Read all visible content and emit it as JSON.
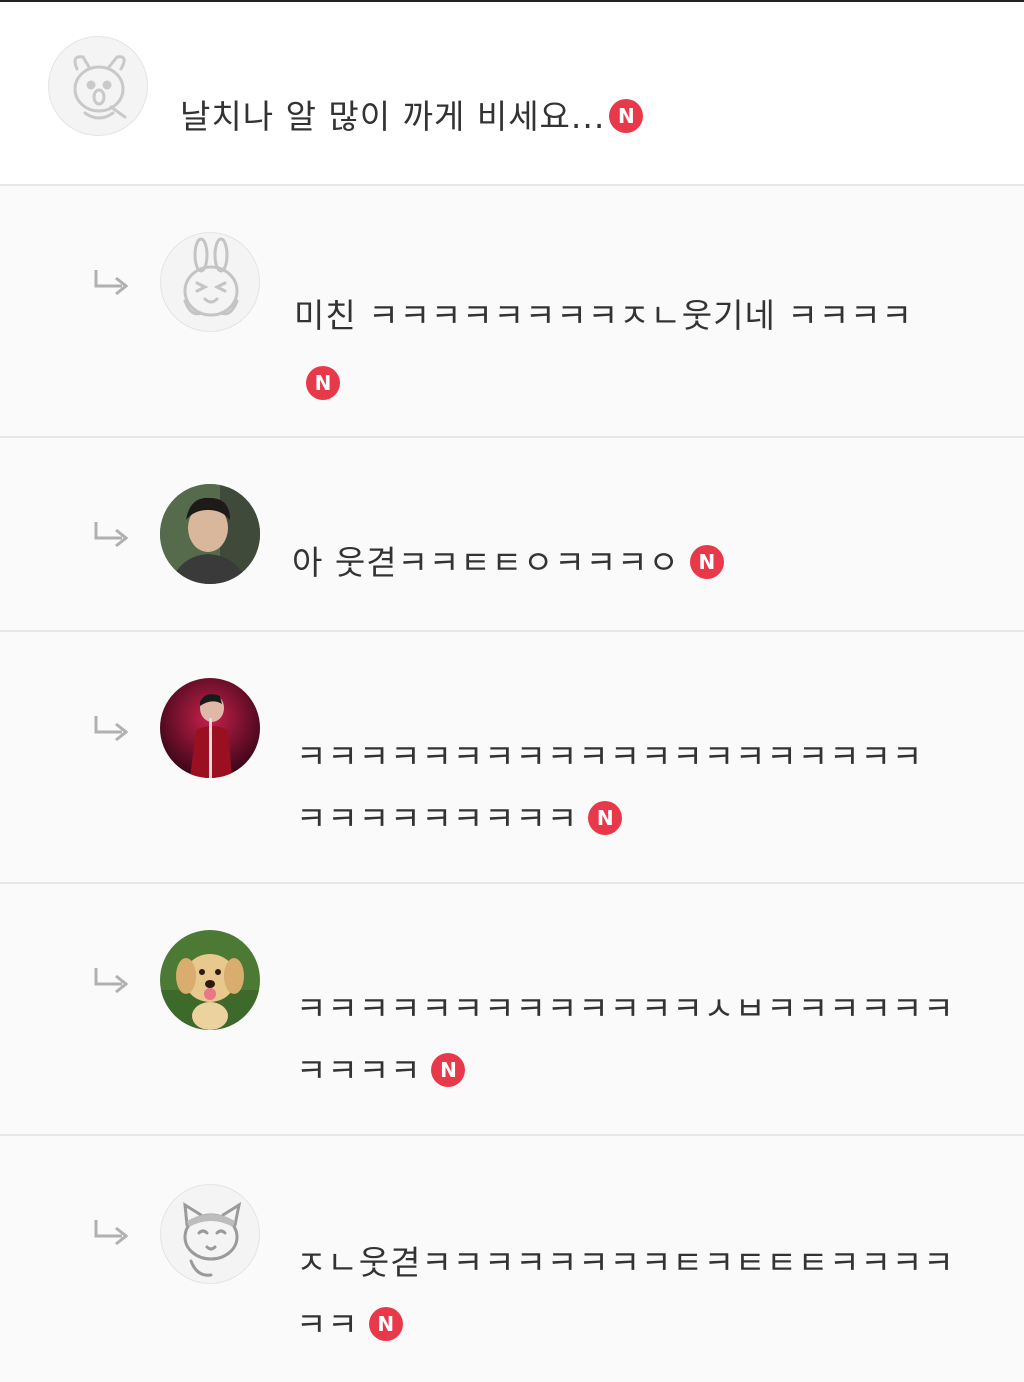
{
  "comments": [
    {
      "text": "날치나 알 많이 까게 비세요...",
      "avatar": "dog-character-icon",
      "badge": "N"
    },
    {
      "text": "미친 ㅋㅋㅋㅋㅋㅋㅋㅋㅈㄴ웃기네 ㅋㅋㅋㅋ",
      "avatar": "rabbit-character-icon",
      "badge": "N"
    },
    {
      "text": "아 웃겯ㅋㅋㅌㅌㅇㅋㅋㅋㅇ",
      "avatar": "profile-photo-man",
      "badge": "N"
    },
    {
      "text": "ㅋㅋㅋㅋㅋㅋㅋㅋㅋㅋㅋㅋㅋㅋㅋㅋㅋㅋㅋㅋ",
      "text2": "ㅋㅋㅋㅋㅋㅋㅋㅋㅋ",
      "avatar": "profile-photo-singer",
      "badge": "N"
    },
    {
      "text": "ㅋㅋㅋㅋㅋㅋㅋㅋㅋㅋㅋㅋㅋㅅㅂㅋㅋㅋㅋㅋㅋ",
      "text2": "ㅋㅋㅋㅋ",
      "avatar": "profile-photo-puppy",
      "badge": "N"
    },
    {
      "text": "ㅈㄴ웃겯ㅋㅋㅋㅋㅋㅋㅋㅋㅌㅋㅌㅌㅌㅋㅋㅋㅋ",
      "text2": "ㅋㅋ",
      "avatar": "cat-character-icon",
      "badge": "N"
    }
  ],
  "reply_icon": "reply-arrow-icon",
  "colors": {
    "badge": "#e8394a",
    "divider": "#e6e6e6",
    "text": "#333333"
  }
}
